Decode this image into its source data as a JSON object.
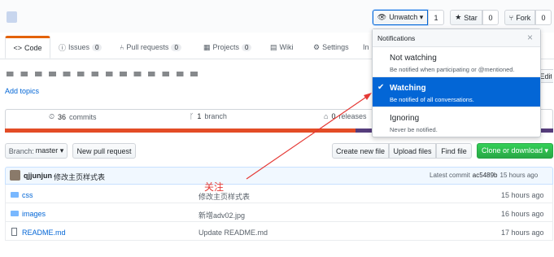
{
  "header": {
    "repo_name": "…",
    "unwatch_label": "Unwatch ▾",
    "watch_count": "1",
    "star_label": "Star",
    "star_count": "0",
    "fork_label": "Fork",
    "fork_count": "0"
  },
  "tabs": [
    {
      "label": "Code",
      "icon": "code-icon",
      "count": ""
    },
    {
      "label": "Issues",
      "icon": "issue-icon",
      "count": "0"
    },
    {
      "label": "Pull requests",
      "icon": "pull-request-icon",
      "count": "0"
    },
    {
      "label": "Projects",
      "icon": "project-icon",
      "count": "0"
    },
    {
      "label": "Wiki",
      "icon": "book-icon",
      "count": ""
    },
    {
      "label": "Settings",
      "icon": "gear-icon",
      "count": ""
    },
    {
      "label": "In",
      "icon": "",
      "count": ""
    }
  ],
  "description": {
    "edit_label": "Edit",
    "add_topics": "Add topics"
  },
  "summary": {
    "commits": "36",
    "commits_label": "commits",
    "branches": "1",
    "branch_label": "branch",
    "releases": "0",
    "releases_label": "releases"
  },
  "toolbar": {
    "branch_prefix": "Branch:",
    "branch_name": "master ▾",
    "new_pr": "New pull request",
    "create_file": "Create new file",
    "upload_files": "Upload files",
    "find_file": "Find file",
    "clone": "Clone or download ▾"
  },
  "latest_commit": {
    "author": "qjjunjun",
    "message": "修改主页样式表",
    "label": "Latest commit",
    "sha": "ac5489b",
    "age": "15 hours ago"
  },
  "files": [
    {
      "name": "css",
      "type": "folder",
      "message": "修改主页样式表",
      "age": "15 hours ago"
    },
    {
      "name": "images",
      "type": "folder",
      "message": "新增adv02.jpg",
      "age": "16 hours ago"
    },
    {
      "name": "README.md",
      "type": "file",
      "message": "Update README.md",
      "age": "17 hours ago"
    }
  ],
  "notifications": {
    "title": "Notifications",
    "close": "×",
    "options": [
      {
        "title": "Not watching",
        "desc": "Be notified when participating or @mentioned.",
        "selected": false
      },
      {
        "title": "Watching",
        "desc": "Be notified of all conversations.",
        "selected": true
      },
      {
        "title": "Ignoring",
        "desc": "Never be notified.",
        "selected": false
      }
    ]
  },
  "annotation": {
    "text": "关注",
    "color": "#e53935"
  },
  "colors": {
    "accent": "#0366d6",
    "tab_active": "#e36209",
    "clone_green": "#28a745",
    "lang_red": "#e34c26",
    "lang_purple": "#563d7c"
  },
  "language_fractions": [
    {
      "color": "#e34c26",
      "fraction": 0.64
    },
    {
      "color": "#563d7c",
      "fraction": 0.36
    }
  ]
}
